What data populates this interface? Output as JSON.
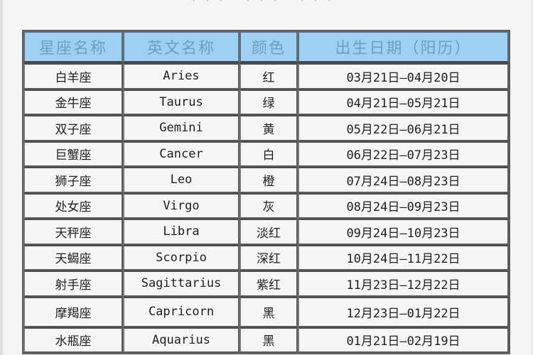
{
  "page": {
    "top_title_fragment": "··· ··· ···"
  },
  "table": {
    "headers": {
      "cn_name": "星座名称",
      "en_name": "英文名称",
      "color": "颜色",
      "birth_date": "出生日期（阳历）"
    },
    "rows": [
      {
        "cn": "白羊座",
        "en": "Aries",
        "color": "红",
        "date": "03月21日—04月20日"
      },
      {
        "cn": "金牛座",
        "en": "Taurus",
        "color": "绿",
        "date": "04月21日—05月21日"
      },
      {
        "cn": "双子座",
        "en": "Gemini",
        "color": "黄",
        "date": "05月22日—06月21日"
      },
      {
        "cn": "巨蟹座",
        "en": "Cancer",
        "color": "白",
        "date": "06月22日—07月23日"
      },
      {
        "cn": "狮子座",
        "en": "Leo",
        "color": "橙",
        "date": "07月24日—08月23日"
      },
      {
        "cn": "处女座",
        "en": "Virgo",
        "color": "灰",
        "date": "08月24日—09月23日"
      },
      {
        "cn": "天秤座",
        "en": "Libra",
        "color": "淡红",
        "date": "09月24日—10月23日"
      },
      {
        "cn": "天蝎座",
        "en": "Scorpio",
        "color": "深红",
        "date": "10月24日—11月22日"
      },
      {
        "cn": "射手座",
        "en": "Sagittarius",
        "color": "紫红",
        "date": "11月23日—12月22日"
      },
      {
        "cn": "摩羯座",
        "en": "Capricorn",
        "color": "黑",
        "date": "12月23日—01月22日"
      },
      {
        "cn": "水瓶座",
        "en": "Aquarius",
        "color": "黑",
        "date": "01月21日—02月19日"
      }
    ]
  },
  "colors": {
    "header_bg": "#9fd0f4",
    "header_text": "#6c9fc0",
    "cell_bg": "#f6f6f4",
    "border": "#5a5c5a"
  }
}
